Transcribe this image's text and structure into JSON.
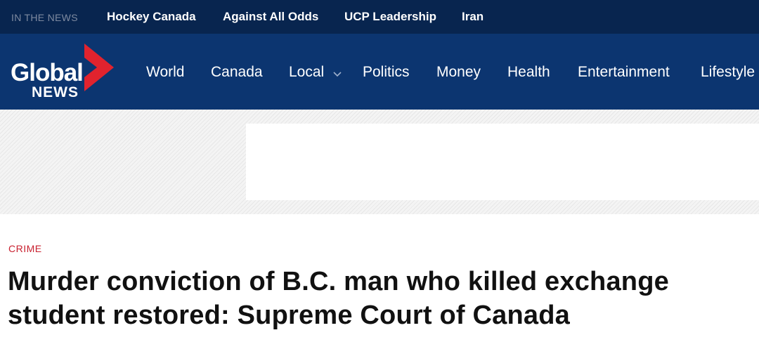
{
  "topbar": {
    "label": "IN THE NEWS",
    "trending": [
      "Hockey Canada",
      "Against All Odds",
      "UCP Leadership",
      "Iran"
    ]
  },
  "logo": {
    "line1": "Global",
    "line2": "NEWS",
    "chevron_color": "#e1232e"
  },
  "nav": {
    "items": [
      "World",
      "Canada",
      "Local",
      "Politics",
      "Money",
      "Health",
      "Entertainment",
      "Lifestyle"
    ],
    "dropdown_icon": "chevron-down-icon"
  },
  "article": {
    "category": "CRIME",
    "headline": "Murder conviction of B.C. man who killed exchange student restored: Supreme Court of Canada"
  },
  "colors": {
    "topbar_bg": "#08254f",
    "nav_bg": "#0c3570",
    "accent_red": "#c8202f"
  }
}
